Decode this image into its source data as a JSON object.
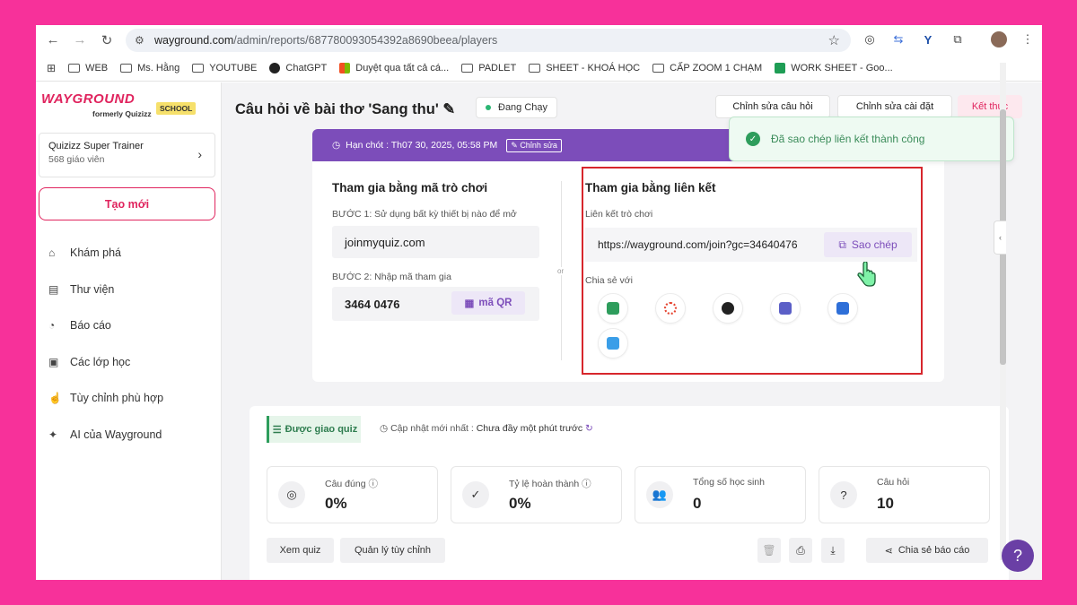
{
  "browser": {
    "url_host": "wayground.com",
    "url_path": "/admin/reports/687780093054392a8690beea/players",
    "bookmarks": [
      "WEB",
      "Ms. Hằng",
      "YOUTUBE",
      "ChatGPT",
      "Duyệt qua tất cả cá...",
      "PADLET",
      "SHEET - KHOÁ HỌC",
      "CẤP ZOOM 1 CHẠM",
      "WORK SHEET - Goo..."
    ]
  },
  "sidebar": {
    "logo": "WAYGROUND",
    "logo_sub": "formerly Quizizz",
    "school": "SCHOOL",
    "trainer_title": "Quizizz Super Trainer",
    "trainer_count": "568 giáo viên",
    "create": "Tạo mới",
    "items": [
      {
        "label": "Khám phá",
        "icon": "home-icon"
      },
      {
        "label": "Thư viện",
        "icon": "library-icon"
      },
      {
        "label": "Báo cáo",
        "icon": "report-icon"
      },
      {
        "label": "Các lớp học",
        "icon": "class-icon"
      },
      {
        "label": "Tùy chỉnh phù hợp",
        "icon": "customize-icon"
      },
      {
        "label": "AI của Wayground",
        "icon": "ai-sparkle-icon"
      }
    ]
  },
  "header": {
    "title": "Câu hỏi về bài thơ 'Sang thu'",
    "status": "Đang Chạy",
    "edit_questions": "Chỉnh sửa câu hỏi",
    "edit_settings": "Chỉnh sửa cài đặt",
    "end": "Kết thúc"
  },
  "toast": {
    "text": "Đã sao chép liên kết thành công"
  },
  "banner": {
    "deadline": "Hạn chót : Th07 30, 2025, 05:58 PM",
    "edit": "Chỉnh sửa"
  },
  "join_code": {
    "title": "Tham gia bằng mã trò chơi",
    "step1": "BƯỚC 1: Sử dụng bất kỳ thiết bị nào để mở",
    "site": "joinmyquiz.com",
    "step2": "BƯỚC 2: Nhập mã tham gia",
    "code": "3464 0476",
    "qr": "mã QR",
    "or": "or"
  },
  "join_link": {
    "title": "Tham gia bằng liên kết",
    "label": "Liên kết trò chơi",
    "link": "https://wayground.com/join?gc=34640476",
    "copy": "Sao chép",
    "share_label": "Chia sẻ với",
    "share_targets": [
      {
        "name": "google-classroom-icon",
        "color": "#2e9d5c"
      },
      {
        "name": "canvas-icon",
        "color": "#e5432f"
      },
      {
        "name": "schoology-icon",
        "color": "#222222"
      },
      {
        "name": "teams-icon",
        "color": "#5b5fc7"
      },
      {
        "name": "remind-icon",
        "color": "#2e6fd8"
      },
      {
        "name": "twitter-icon",
        "color": "#3a9ee8"
      }
    ]
  },
  "stats": {
    "tag": "Được giao quiz",
    "updated_label": "Cập nhật mới nhất :",
    "updated_value": "Chưa đầy một phút trước",
    "cards": [
      {
        "label": "Câu đúng",
        "value": "0%",
        "icon": "target-icon"
      },
      {
        "label": "Tỷ lệ hoàn thành",
        "value": "0%",
        "icon": "check-circle-icon"
      },
      {
        "label": "Tổng số học sinh",
        "value": "0",
        "icon": "users-icon"
      },
      {
        "label": "Câu hỏi",
        "value": "10",
        "icon": "question-icon"
      }
    ],
    "view_quiz": "Xem quiz",
    "manage": "Quản lý tùy chỉnh",
    "share_report": "Chia sẻ báo cáo"
  },
  "help": "?"
}
